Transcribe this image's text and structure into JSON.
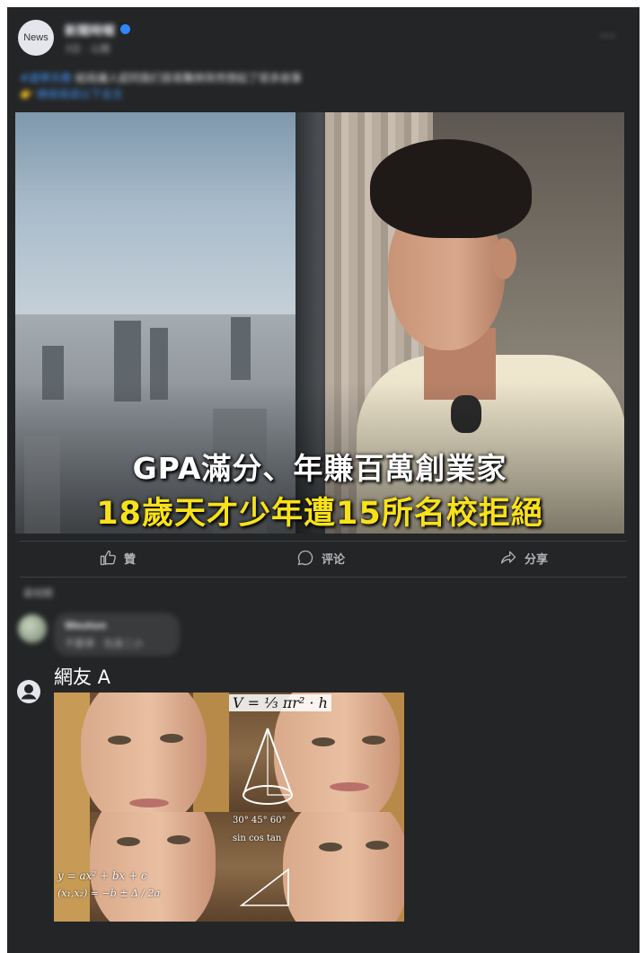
{
  "post": {
    "avatar_text": "News",
    "page_name": "新聞時報",
    "meta": "3日 · 公開",
    "more": "···",
    "text_hashtag": "#遊學天教",
    "text_body": " 結局讓人認同我们容易難倒突然想起了很多故事",
    "text_link": "👉 继续阅读以下全文",
    "image_caption_line1": "GPA滿分、年賺百萬創業家",
    "image_caption_line2": "18歲天才少年遭15所名校拒絕"
  },
  "actions": {
    "like_label": "贊",
    "comment_label": "评论",
    "share_label": "分享"
  },
  "comments": {
    "sort_label": "最相關",
    "blurred_name": "Weston",
    "blurred_text": "不要律 · 包身二小"
  },
  "netizen_comment": {
    "author": "網友 A",
    "meme_formula": "V = ⅓ πr² · h"
  },
  "colors": {
    "frame_bg": "#242526",
    "caption_yellow": "#f8e11a",
    "verified_blue": "#2d88ff"
  },
  "icons": {
    "like": "thumbs-up-icon",
    "comment": "speech-bubble-icon",
    "share": "share-arrow-icon",
    "user": "user-avatar-icon"
  }
}
